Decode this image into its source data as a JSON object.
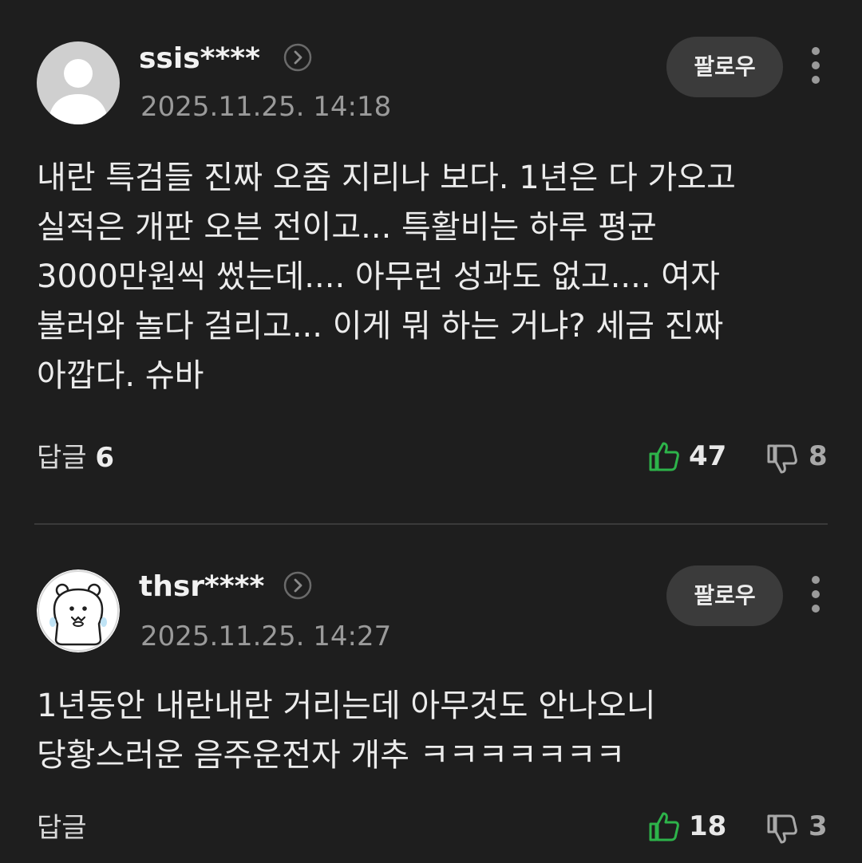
{
  "comments": [
    {
      "username": "ssis****",
      "timestamp": "2025.11.25. 14:18",
      "follow_label": "팔로우",
      "body": "내란 특검들 진짜 오줌 지리나 보다. 1년은 다 가오고 실적은 개판 오븐 전이고... 특활비는 하루 평균 3000만원씩 썼는데.... 아무런 성과도 없고.... 여자 불러와 놀다 걸리고... 이게 뭐 하는 거냐? 세금 진짜 아깝다. 슈바",
      "reply_label": "답글",
      "reply_count": "6",
      "likes": "47",
      "dislikes": "8",
      "avatar": "default-user-avatar"
    },
    {
      "username": "thsr****",
      "timestamp": "2025.11.25. 14:27",
      "follow_label": "팔로우",
      "body": "1년동안 내란내란 거리는데 아무것도 안나오니 당황스러운 음주운전자 개추 ㅋㅋㅋㅋㅋㅋㅋ",
      "reply_label": "답글",
      "reply_count": "",
      "likes": "18",
      "dislikes": "3",
      "avatar": "bear-character-avatar"
    }
  ],
  "colors": {
    "background": "#1e1e1e",
    "like_green": "#2db34a",
    "follow_bg": "#3b3b3b",
    "timestamp": "#9a9a9a"
  }
}
